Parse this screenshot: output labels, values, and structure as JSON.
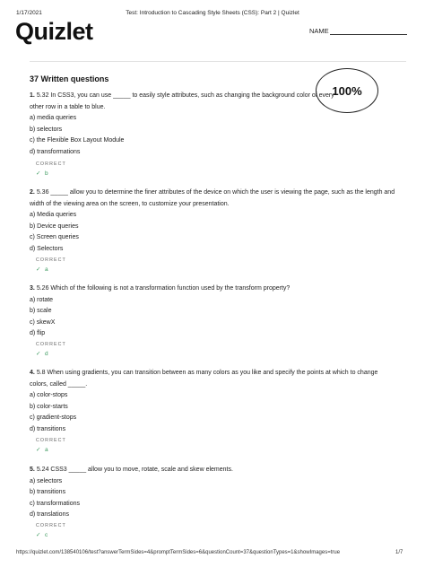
{
  "header": {
    "date": "1/17/2021",
    "title": "Test: Introduction to Cascading Style Sheets (CSS): Part 2 | Quizlet"
  },
  "brand": {
    "logo": "Quizlet"
  },
  "name_label": "NAME",
  "section_title": "37 Written questions",
  "score": "100%",
  "questions": [
    {
      "num": "1.",
      "text": "5.32 In CSS3, you can use _____ to easily style attributes, such as changing the background color of every other row in a table to blue.",
      "options": [
        "a) media queries",
        "b) selectors",
        "c) the Flexible Box Layout Module",
        "d) transformations"
      ],
      "status": "CORRECT",
      "answer": "b"
    },
    {
      "num": "2.",
      "text": "5.36 _____ allow you to determine the finer attributes of the device on which the user is viewing the page, such as the length and width of the viewing area on the screen, to customize your presentation.",
      "options": [
        "a) Media queries",
        "b) Device queries",
        "c) Screen queries",
        "d) Selectors"
      ],
      "status": "CORRECT",
      "answer": "a"
    },
    {
      "num": "3.",
      "text": "5.26 Which of the following is not a transformation function used by the transform property?",
      "options": [
        "a) rotate",
        "b) scale",
        "c) skewX",
        "d) flip"
      ],
      "status": "CORRECT",
      "answer": "d"
    },
    {
      "num": "4.",
      "text": "5.8 When using gradients, you can transition between as many colors as you like and specify the points at which to change colors, called _____.",
      "options": [
        "a) color-stops",
        "b) color-starts",
        "c) gradient-stops",
        "d) transitions"
      ],
      "status": "CORRECT",
      "answer": "a"
    },
    {
      "num": "5.",
      "text": "5.24 CSS3 _____ allow you to move, rotate, scale and skew elements.",
      "options": [
        "a) selectors",
        "b) transitions",
        "c) transformations",
        "d) translations"
      ],
      "status": "CORRECT",
      "answer": "c"
    }
  ],
  "check_mark": "✓",
  "colors": {
    "correct": "#3c9a5f"
  },
  "footer": {
    "url": "https://quizlet.com/138540106/test?answerTermSides=4&promptTermSides=6&questionCount=37&questionTypes=1&showImages=true",
    "page": "1/7"
  }
}
